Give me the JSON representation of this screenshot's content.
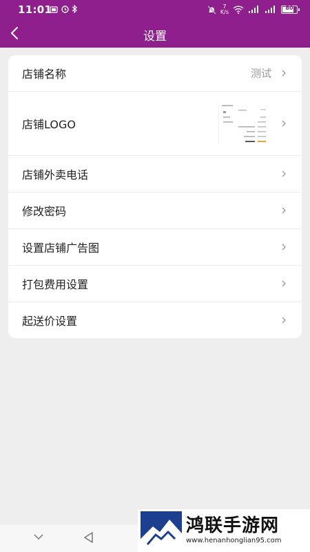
{
  "status": {
    "time": "11:01",
    "left_icons": [
      "sim-card-icon",
      "alarm-icon",
      "bluetooth-icon"
    ],
    "speed_value": "7",
    "speed_unit": "K/s",
    "battery": "80"
  },
  "nav": {
    "title": "设置"
  },
  "settings": {
    "items": [
      {
        "label": "店铺名称",
        "value": "测试"
      },
      {
        "label": "店铺LOGO"
      },
      {
        "label": "店铺外卖电话"
      },
      {
        "label": "修改密码"
      },
      {
        "label": "设置店铺广告图"
      },
      {
        "label": "打包费用设置"
      },
      {
        "label": "起送价设置"
      }
    ]
  },
  "watermark": {
    "title": "鸿联手游网",
    "url": "www.henanhonglian95.com"
  },
  "colors": {
    "brand": "#8e1f8c",
    "background": "#eeeeee"
  }
}
